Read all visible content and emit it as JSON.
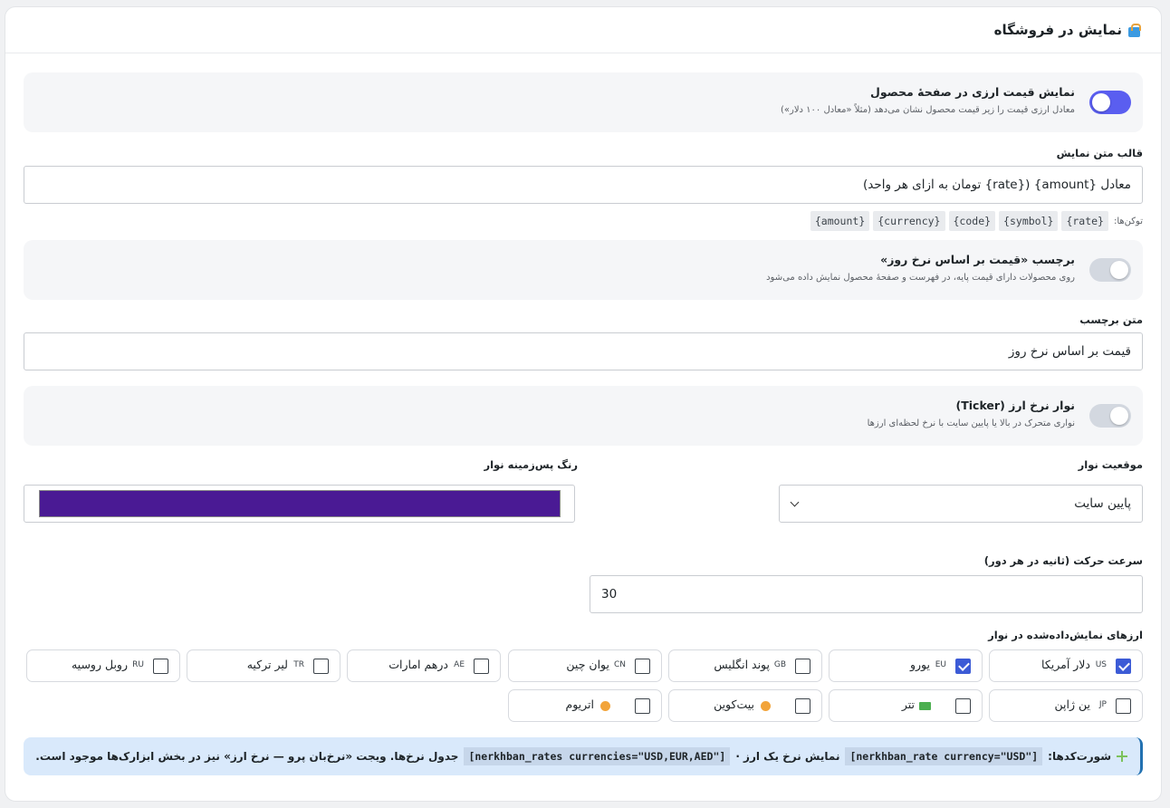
{
  "header": {
    "title": "نمایش در فروشگاه",
    "icon": "shopping-bag-icon"
  },
  "price_toggle": {
    "title": "نمایش قیمت ارزی در صفحهٔ محصول",
    "desc": "معادل ارزی قیمت را زیر قیمت محصول نشان می‌دهد (مثلاً «معادل ۱۰۰ دلار»)",
    "on": true
  },
  "template": {
    "label": "قالب متن نمایش",
    "value": "معادل {amount} ({rate} تومان به ازای هر واحد)",
    "tokens_label": "توکن‌ها:",
    "tokens": [
      "{rate}",
      "{symbol}",
      "{code}",
      "{currency}",
      "{amount}"
    ]
  },
  "badge_toggle": {
    "title": "برچسب «قیمت بر اساس نرخ روز»",
    "desc": "روی محصولات دارای قیمت پایه، در فهرست و صفحهٔ محصول نمایش داده می‌شود",
    "on": false
  },
  "badge_text": {
    "label": "متن برچسب",
    "value": "قیمت بر اساس نرخ روز"
  },
  "ticker_toggle": {
    "title": "نوار نرخ ارز (Ticker)",
    "desc": "نواری متحرک در بالا یا پایین سایت با نرخ لحظه‌ای ارزها",
    "on": false
  },
  "position": {
    "label": "موقعیت نوار",
    "value": "پایین سایت"
  },
  "bg_color": {
    "label": "رنگ پس‌زمینه نوار",
    "value": "#4a1a94"
  },
  "speed": {
    "label": "سرعت حرکت (ثانیه در هر دور)",
    "value": "30"
  },
  "currencies": {
    "label": "ارزهای نمایش‌داده‌شده در نوار",
    "items": [
      {
        "code": "US",
        "name": "دلار آمریکا",
        "checked": true
      },
      {
        "code": "EU",
        "name": "یورو",
        "checked": true
      },
      {
        "code": "GB",
        "name": "پوند انگلیس",
        "checked": false
      },
      {
        "code": "CN",
        "name": "یوان چین",
        "checked": false
      },
      {
        "code": "AE",
        "name": "درهم امارات",
        "checked": false
      },
      {
        "code": "TR",
        "name": "لیر ترکیه",
        "checked": false
      },
      {
        "code": "RU",
        "name": "روبل روسیه",
        "checked": false
      },
      {
        "code": "JP",
        "name": "ین ژاپن",
        "checked": false
      },
      {
        "name": "تتر",
        "icon": "cash-icon",
        "checked": false
      },
      {
        "name": "بیت‌کوین",
        "icon": "coin-icon",
        "checked": false
      },
      {
        "name": "اتریوم",
        "icon": "coin-icon",
        "checked": false
      }
    ]
  },
  "info": {
    "prefix": "شورت‌کدها:",
    "code1": "[nerkhban_rate currency=\"USD\"]",
    "mid": "نمایش نرخ یک ارز ·",
    "code2": "[nerkhban_rates currencies=\"USD,EUR,AED\"]",
    "suffix": "جدول نرخ‌ها. ویجت «نرخ‌بان پرو — نرخ ارز» نیز در بخش ابزارک‌ها موجود است."
  }
}
